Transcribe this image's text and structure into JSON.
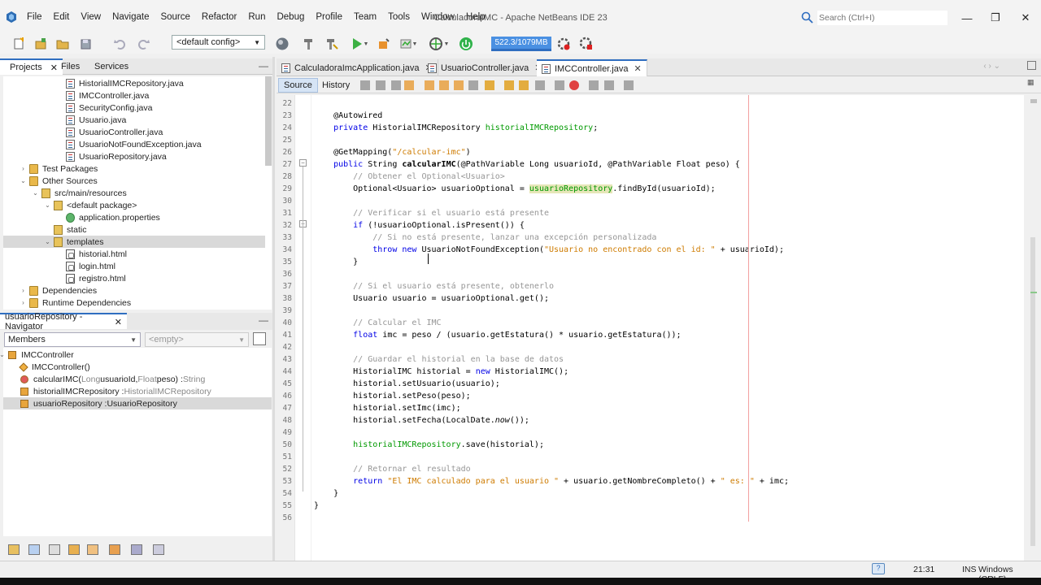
{
  "window": {
    "title": "CalculadoraIMC - Apache NetBeans IDE 23",
    "search_placeholder": "Search (Ctrl+I)"
  },
  "menu": [
    "File",
    "Edit",
    "View",
    "Navigate",
    "Source",
    "Refactor",
    "Run",
    "Debug",
    "Profile",
    "Team",
    "Tools",
    "Window",
    "Help"
  ],
  "toolbar": {
    "config": "<default config>",
    "memory": "522.3/1079MB"
  },
  "projects_panel": {
    "tabs": [
      "Projects",
      "Files",
      "Services"
    ],
    "active_tab": "Projects",
    "tree": [
      {
        "label": "HistorialIMCRepository.java",
        "type": "java",
        "indent": 5
      },
      {
        "label": "IMCController.java",
        "type": "java",
        "indent": 5
      },
      {
        "label": "SecurityConfig.java",
        "type": "java",
        "indent": 5
      },
      {
        "label": "Usuario.java",
        "type": "java",
        "indent": 5
      },
      {
        "label": "UsuarioController.java",
        "type": "java",
        "indent": 5
      },
      {
        "label": "UsuarioNotFoundException.java",
        "type": "java",
        "indent": 5
      },
      {
        "label": "UsuarioRepository.java",
        "type": "java",
        "indent": 5
      },
      {
        "label": "Test Packages",
        "type": "folder",
        "indent": 2,
        "toggle": "closed"
      },
      {
        "label": "Other Sources",
        "type": "folder",
        "indent": 2,
        "toggle": "open"
      },
      {
        "label": "src/main/resources",
        "type": "pkg",
        "indent": 3,
        "toggle": "open"
      },
      {
        "label": "<default package>",
        "type": "pkg",
        "indent": 4,
        "toggle": "open"
      },
      {
        "label": "application.properties",
        "type": "props",
        "indent": 5
      },
      {
        "label": "static",
        "type": "pkg",
        "indent": 4
      },
      {
        "label": "templates",
        "type": "pkg",
        "indent": 4,
        "toggle": "open",
        "selected": true
      },
      {
        "label": "historial.html",
        "type": "html",
        "indent": 5
      },
      {
        "label": "login.html",
        "type": "html",
        "indent": 5
      },
      {
        "label": "registro.html",
        "type": "html",
        "indent": 5
      },
      {
        "label": "Dependencies",
        "type": "folder",
        "indent": 2,
        "toggle": "closed"
      },
      {
        "label": "Runtime Dependencies",
        "type": "folder",
        "indent": 2,
        "toggle": "closed"
      }
    ]
  },
  "navigator": {
    "title": "usuarioRepository - Navigator",
    "filter": "Members",
    "empty": "<empty>",
    "items": [
      {
        "label": "IMCController",
        "suffix": "",
        "kind": "class",
        "indent": 0
      },
      {
        "label": "IMCController()",
        "suffix": "",
        "kind": "ctor",
        "indent": 1
      },
      {
        "label": "calcularIMC(",
        "params_pre": "Long",
        "p1": " usuarioId, ",
        "params_pre2": "Float",
        "p2": " peso) : ",
        "suffix": "String",
        "kind": "method",
        "indent": 1
      },
      {
        "label": "historialIMCRepository : ",
        "suffix": "HistorialIMCRepository",
        "kind": "field",
        "indent": 1
      },
      {
        "label": "usuarioRepository : ",
        "suffix": "UsuarioRepository",
        "kind": "field",
        "indent": 1,
        "selected": true
      }
    ]
  },
  "editor": {
    "tabs": [
      {
        "label": "CalculadoraImcApplication.java",
        "active": false
      },
      {
        "label": "UsuarioController.java",
        "active": false
      },
      {
        "label": "IMCController.java",
        "active": true
      }
    ],
    "source_label": "Source",
    "history_label": "History",
    "first_line": 22
  },
  "status": {
    "position": "21:31",
    "mode": "INS",
    "line_endings": "Windows (CRLF)"
  }
}
